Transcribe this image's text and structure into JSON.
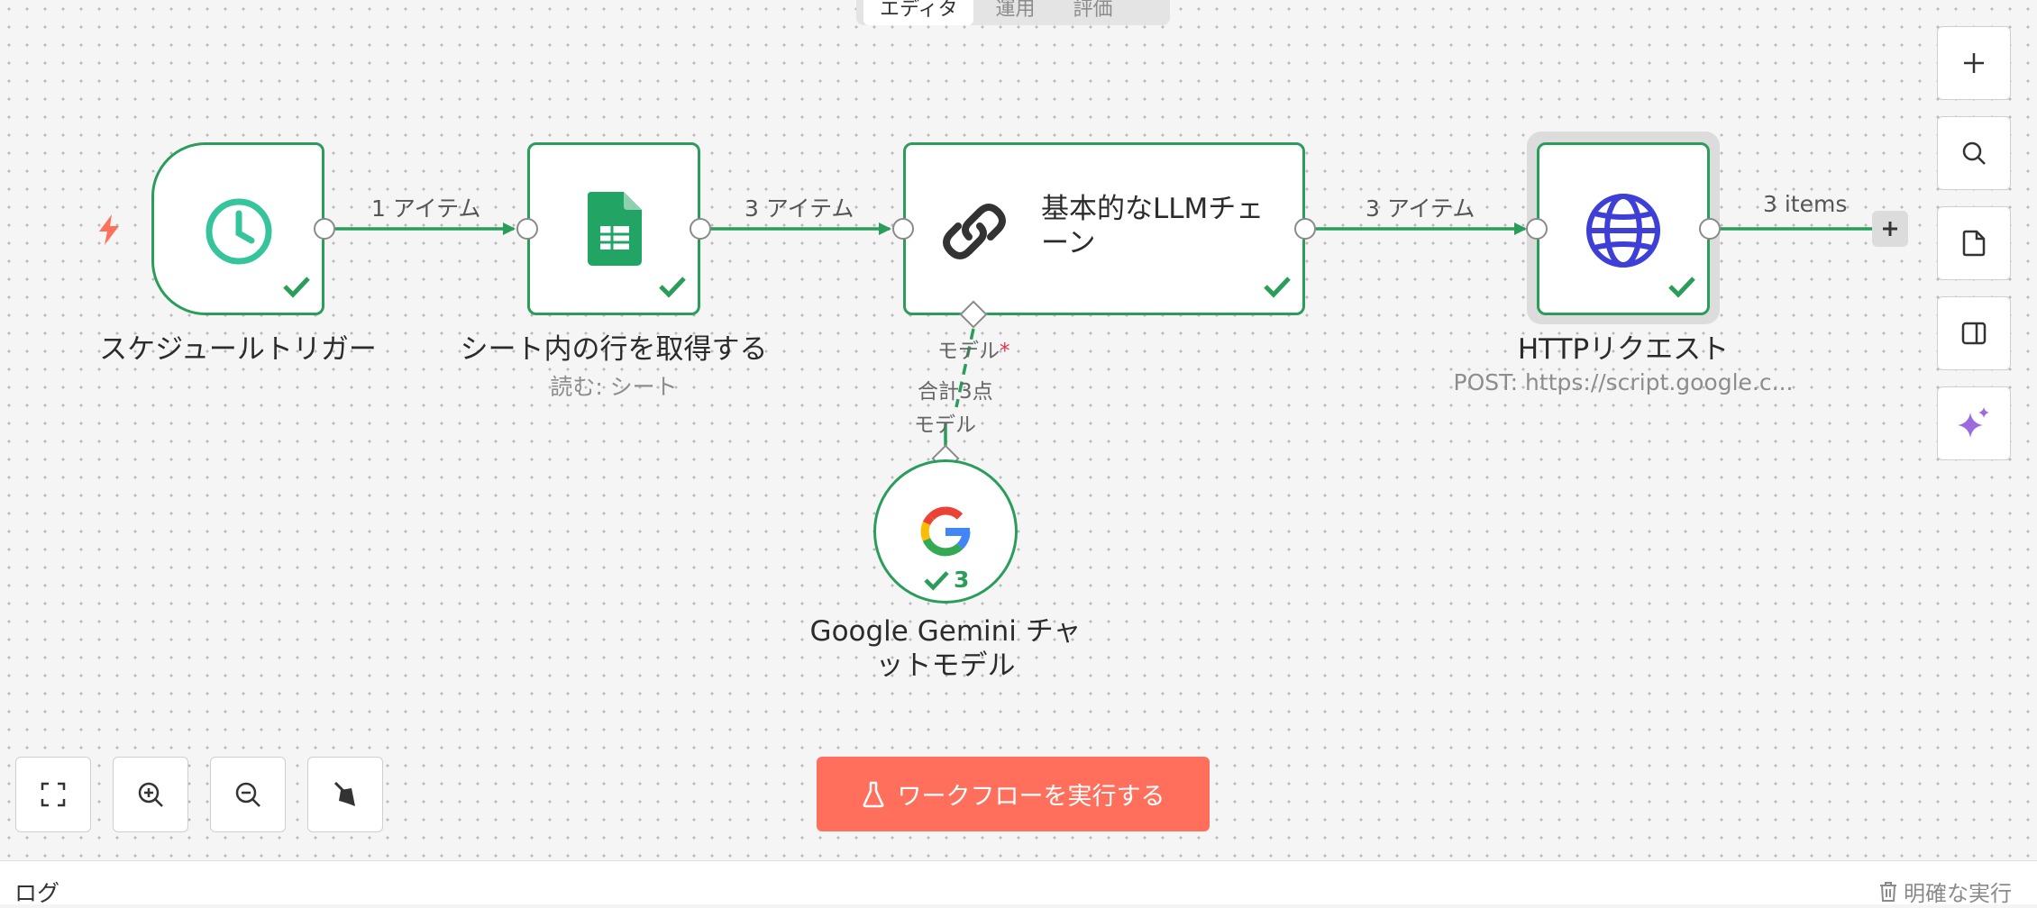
{
  "tabs": [
    {
      "label": "エディタ"
    },
    {
      "label": "運用"
    },
    {
      "label": "評価"
    }
  ],
  "nodes": {
    "schedule": {
      "label": "スケジュールトリガー",
      "icon": "clock-icon"
    },
    "sheets": {
      "label": "シート内の行を取得する",
      "sub": "読む: シート",
      "icon": "google-sheets-icon"
    },
    "llm": {
      "label_line1": "基本的なLLMチェ",
      "label_line2": "ーン",
      "icon": "link-icon"
    },
    "http": {
      "label": "HTTPリクエスト",
      "sub": "POST: https://script.google.c...",
      "icon": "globe-icon"
    },
    "gemini": {
      "label_line1": "Google Gemini チャ",
      "label_line2": "ットモデル",
      "run_count": "3",
      "icon": "google-icon"
    }
  },
  "edges": {
    "e1": "1 アイテム",
    "e2": "3 アイテム",
    "e3": "3 アイテム",
    "e4": "3 items"
  },
  "model_connection": {
    "top_label": "モデル",
    "required_mark": "*",
    "total": "合計3点",
    "bottom_label": "モデル"
  },
  "toolbar": {
    "run_label": "ワークフローを実行する"
  },
  "footer": {
    "log_label": "ログ",
    "clear_label": "明確な実行"
  },
  "colors": {
    "success": "#2a9d5a",
    "run_button": "#ff6f5c",
    "trigger": "#ff6f5c",
    "http_globe": "#3d3fd6",
    "sparkle": "#9c6ade"
  }
}
